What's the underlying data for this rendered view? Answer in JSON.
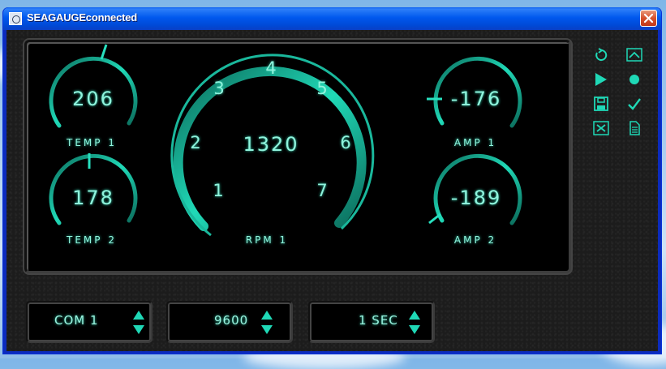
{
  "window": {
    "title": "SEAGAUGEconnected"
  },
  "gauges": {
    "temp1": {
      "label": "TEMP 1",
      "value": "206"
    },
    "temp2": {
      "label": "TEMP 2",
      "value": "178"
    },
    "rpm1": {
      "label": "RPM 1",
      "value": "1320",
      "dial": [
        "1",
        "2",
        "3",
        "4",
        "5",
        "6",
        "7"
      ]
    },
    "amp1": {
      "label": "AMP 1",
      "value": "-176"
    },
    "amp2": {
      "label": "AMP 2",
      "value": "-189"
    }
  },
  "side_buttons": [
    "refresh-icon",
    "chevron-up-icon",
    "play-icon",
    "record-icon",
    "save-icon",
    "check-icon",
    "close-icon",
    "document-icon"
  ],
  "controls": {
    "port": {
      "value": "COM 1"
    },
    "baud": {
      "value": "9600"
    },
    "interval": {
      "value": "1 SEC"
    }
  },
  "colors": {
    "accent": "#1fd8b6",
    "glow": "#8ff3dc",
    "panel": "#000000"
  }
}
